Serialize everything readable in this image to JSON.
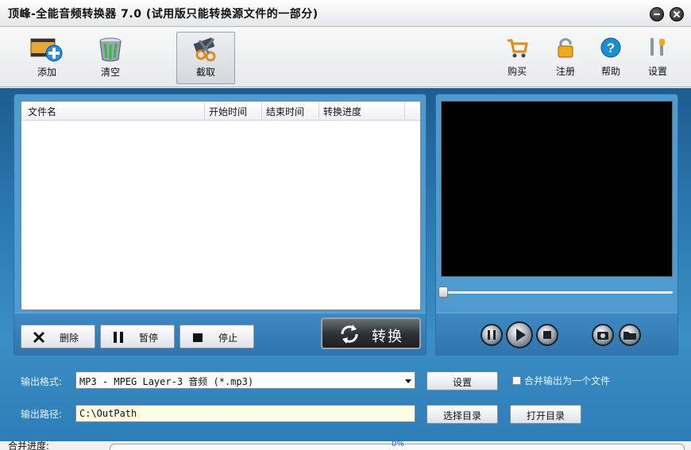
{
  "window": {
    "title": "顶峰-全能音频转换器 7.0 (试用版只能转换源文件的一部分)"
  },
  "toolbar": {
    "add": "添加",
    "clear": "清空",
    "capture": "截取",
    "buy": "购买",
    "register": "注册",
    "help": "帮助",
    "settings": "设置"
  },
  "filelist": {
    "columns": [
      "文件名",
      "开始时间",
      "结束时间",
      "转换进度"
    ],
    "rows": []
  },
  "list_controls": {
    "delete": "删除",
    "pause": "暂停",
    "stop": "停止",
    "convert": "转换"
  },
  "output": {
    "format_label": "输出格式:",
    "format_value": "MP3 - MPEG Layer-3 音频 (*.mp3)",
    "format_settings": "设置",
    "merge_checkbox_label": "合并输出为一个文件",
    "merge_checked": false,
    "path_label": "输出路径:",
    "path_value": "C:\\OutPath",
    "choose_dir": "选择目录",
    "open_dir": "打开目录"
  },
  "merge_progress": {
    "label": "合并进度:",
    "percent": "0%",
    "value": 0
  },
  "colors": {
    "panel_blue": "#2a78b0",
    "video_bg": "#000000",
    "path_bg": "#ffffe3"
  },
  "icons": {
    "add": "film-plus-icon",
    "clear": "trash-can-icon",
    "capture": "scissors-film-icon",
    "buy": "cart-icon",
    "register": "lock-icon",
    "help": "help-icon",
    "settings": "wrench-icon"
  }
}
